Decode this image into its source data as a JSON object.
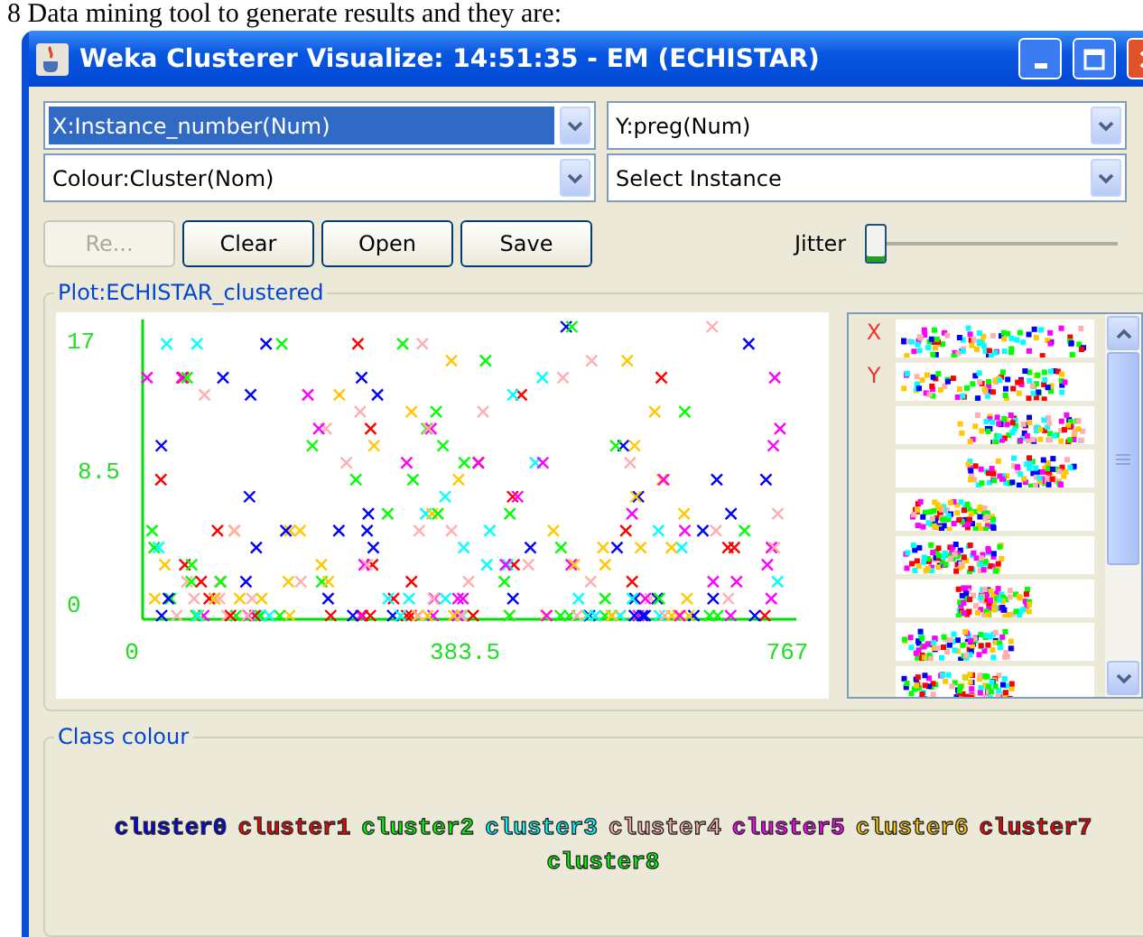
{
  "document_line": "8 Data mining tool to generate results and they are:",
  "window": {
    "title": "Weka Clusterer Visualize: 14:51:35 - EM (ECHISTAR)"
  },
  "selectors": [
    {
      "value": "X:Instance_number(Num)",
      "selected": true
    },
    {
      "value": "Y:preg(Num)",
      "selected": false
    },
    {
      "value": "Colour:Cluster(Nom)",
      "selected": false
    },
    {
      "value": "Select Instance",
      "selected": false
    }
  ],
  "buttons": [
    {
      "label": "Re...",
      "disabled": true
    },
    {
      "label": "Clear",
      "disabled": false
    },
    {
      "label": "Open",
      "disabled": false
    },
    {
      "label": "Save",
      "disabled": false
    }
  ],
  "jitter": {
    "label": "Jitter",
    "level": 0
  },
  "plot": {
    "legend": "Plot:ECHISTAR_clustered",
    "y_ticks": [
      "17",
      "8.5",
      "0"
    ],
    "x_ticks": [
      "0",
      "383.5",
      "767"
    ]
  },
  "attribute_strips": [
    {
      "kind": "strip",
      "marker": "X"
    },
    {
      "kind": "strip",
      "marker": "Y"
    },
    {
      "kind": "strip"
    },
    {
      "kind": "strip"
    },
    {
      "kind": "strip"
    },
    {
      "kind": "strip"
    },
    {
      "kind": "strip"
    },
    {
      "kind": "strip"
    },
    {
      "kind": "strip"
    }
  ],
  "class_colour": {
    "legend": "Class colour",
    "classes": [
      {
        "name": "cluster0",
        "color": "#0000ff"
      },
      {
        "name": "cluster1",
        "color": "#ff0000"
      },
      {
        "name": "cluster2",
        "color": "#00ff00"
      },
      {
        "name": "cluster3",
        "color": "#00ffff"
      },
      {
        "name": "cluster4",
        "color": "#ffafaf"
      },
      {
        "name": "cluster5",
        "color": "#ff00ff"
      },
      {
        "name": "cluster6",
        "color": "#ffc800"
      },
      {
        "name": "cluster7",
        "color": "#ff0000"
      },
      {
        "name": "cluster8",
        "color": "#00ff00"
      }
    ]
  }
}
